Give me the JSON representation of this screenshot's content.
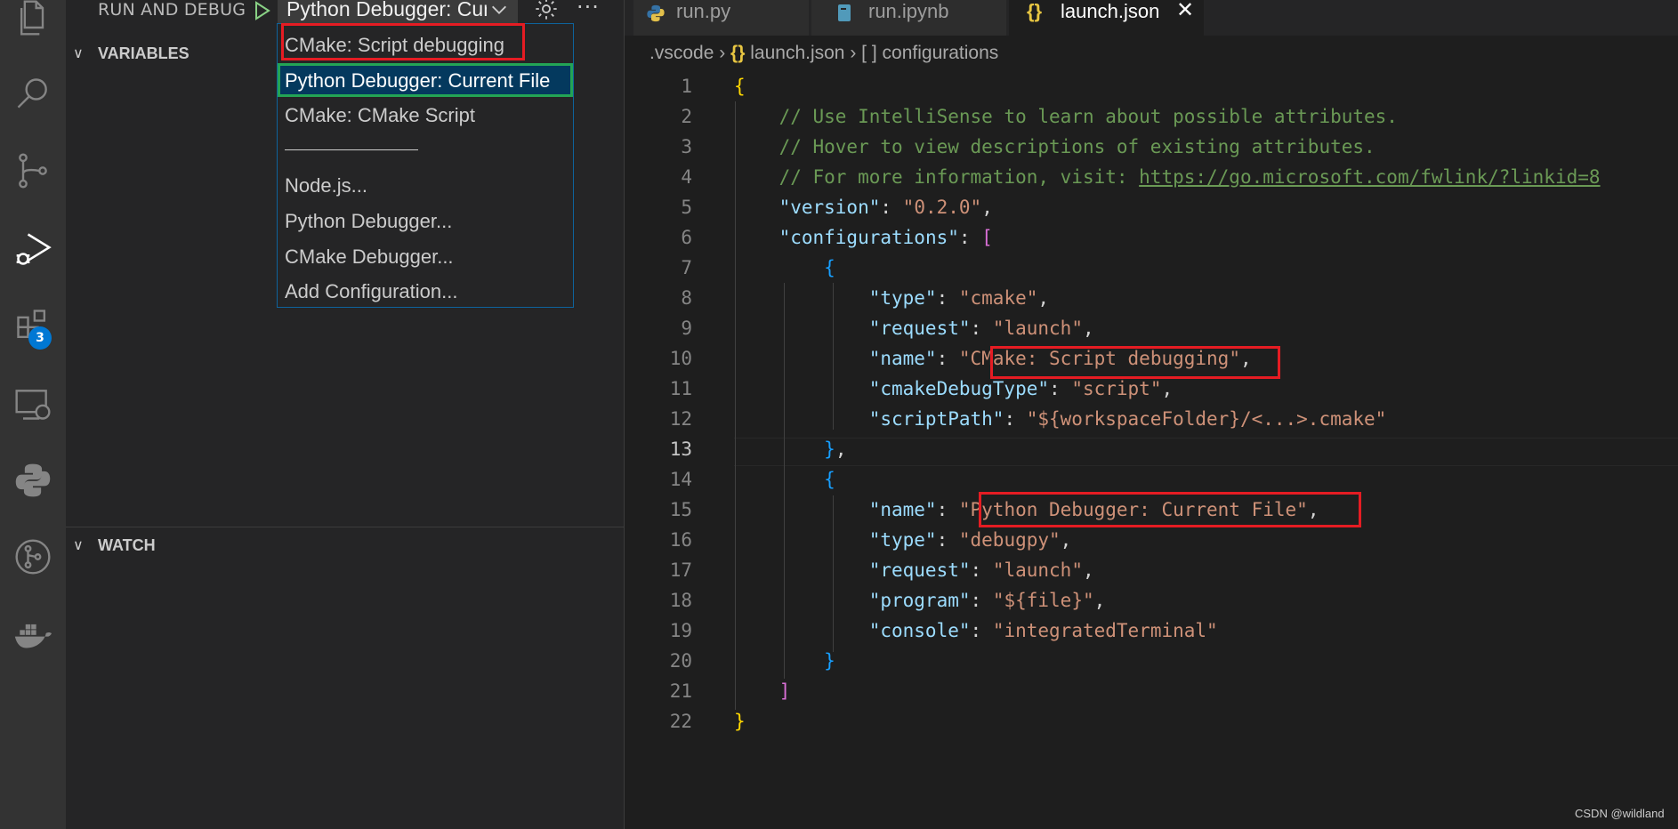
{
  "activity_bar": {
    "icons": [
      "files-icon",
      "search-icon",
      "source-control-icon",
      "run-debug-icon",
      "extensions-icon",
      "remote-explorer-icon",
      "python-icon",
      "git-graph-icon",
      "docker-icon"
    ],
    "extensions_badge": "3"
  },
  "sidebar": {
    "title": "RUN AND DEBUG",
    "selected_config": "Python Debugger: Current File",
    "sections": {
      "variables": "VARIABLES",
      "watch": "WATCH"
    }
  },
  "dropdown": {
    "items": [
      "CMake: Script debugging",
      "Python Debugger: Current File",
      "CMake: CMake Script",
      "Node.js...",
      "Python Debugger...",
      "CMake Debugger...",
      "Add Configuration..."
    ],
    "separator": "———————————"
  },
  "tabs": [
    {
      "label": "run.py",
      "icon": "python-file-icon"
    },
    {
      "label": "run.ipynb",
      "icon": "notebook-file-icon"
    },
    {
      "label": "launch.json",
      "icon": "json-file-icon",
      "active": true
    }
  ],
  "breadcrumb": {
    "folder": ".vscode",
    "file_icon": "{}",
    "file": "launch.json",
    "node_icon": "[ ]",
    "node": "configurations"
  },
  "editor": {
    "line_numbers": [
      "1",
      "2",
      "3",
      "4",
      "5",
      "6",
      "7",
      "8",
      "9",
      "10",
      "11",
      "12",
      "13",
      "14",
      "15",
      "16",
      "17",
      "18",
      "19",
      "20",
      "21",
      "22"
    ],
    "current_line": "13",
    "comments": [
      "// Use IntelliSense to learn about possible attributes.",
      "// Hover to view descriptions of existing attributes.",
      "// For more information, visit: "
    ],
    "comment_link": "https://go.microsoft.com/fwlink/?linkid=8",
    "version_key": "\"version\"",
    "version_value": "\"0.2.0\"",
    "configurations_key": "\"configurations\"",
    "config1": {
      "type_key": "\"type\"",
      "type_value": "\"cmake\"",
      "request_key": "\"request\"",
      "request_value": "\"launch\"",
      "name_key": "\"name\"",
      "name_value_q": "\"",
      "name_value": "CMake: Script debugging",
      "debugtype_key": "\"cmakeDebugType\"",
      "debugtype_value": "\"script\"",
      "scriptpath_key": "\"scriptPath\"",
      "scriptpath_value": "\"${workspaceFolder}/<...>.cmake\""
    },
    "config2": {
      "name_key": "\"name\"",
      "name_value": "\"Python Debugger: Current File\"",
      "type_key": "\"type\"",
      "type_value": "\"debugpy\"",
      "request_key": "\"request\"",
      "request_value": "\"launch\"",
      "program_key": "\"program\"",
      "program_value": "\"${file}\"",
      "console_key": "\"console\"",
      "console_value": "\"integratedTerminal\""
    }
  },
  "watermark": "CSDN @wildland",
  "colors": {
    "accent_blue": "#0078d4",
    "highlight_green": "#23a455",
    "annotation_red": "#e51c23"
  }
}
